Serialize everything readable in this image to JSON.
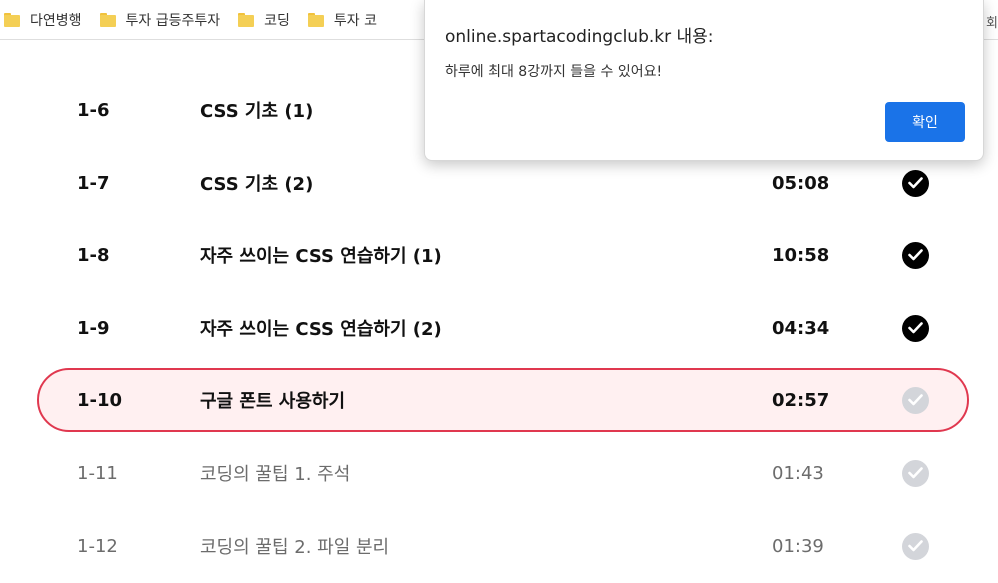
{
  "bookmarks": [
    {
      "label": "다연병행"
    },
    {
      "label": "투자 급등주투자"
    },
    {
      "label": "코딩"
    },
    {
      "label": "투자 코"
    }
  ],
  "bookmarks_overflow": "회",
  "lessons": [
    {
      "num": "1-6",
      "title": "CSS 기초 (1)",
      "time": "",
      "status": "done"
    },
    {
      "num": "1-7",
      "title": "CSS 기초 (2)",
      "time": "05:08",
      "status": "done"
    },
    {
      "num": "1-8",
      "title": "자주 쓰이는 CSS 연습하기 (1)",
      "time": "10:58",
      "status": "done"
    },
    {
      "num": "1-9",
      "title": "자주 쓰이는 CSS 연습하기 (2)",
      "time": "04:34",
      "status": "done"
    },
    {
      "num": "1-10",
      "title": "구글 폰트 사용하기",
      "time": "02:57",
      "status": "current"
    },
    {
      "num": "1-11",
      "title": "코딩의 꿀팁 1. 주석",
      "time": "01:43",
      "status": "pending"
    },
    {
      "num": "1-12",
      "title": "코딩의 꿀팁 2. 파일 분리",
      "time": "01:39",
      "status": "pending"
    }
  ],
  "dialog": {
    "origin": "online.spartacodingclub.kr 내용:",
    "message": "하루에 최대 8강까지 들을 수 있어요!",
    "ok_label": "확인"
  },
  "colors": {
    "accent": "#1a73e8",
    "current_border": "#e0384f",
    "current_bg": "#fff0f1",
    "check_done": "#000000",
    "check_todo": "#d3d5da"
  }
}
